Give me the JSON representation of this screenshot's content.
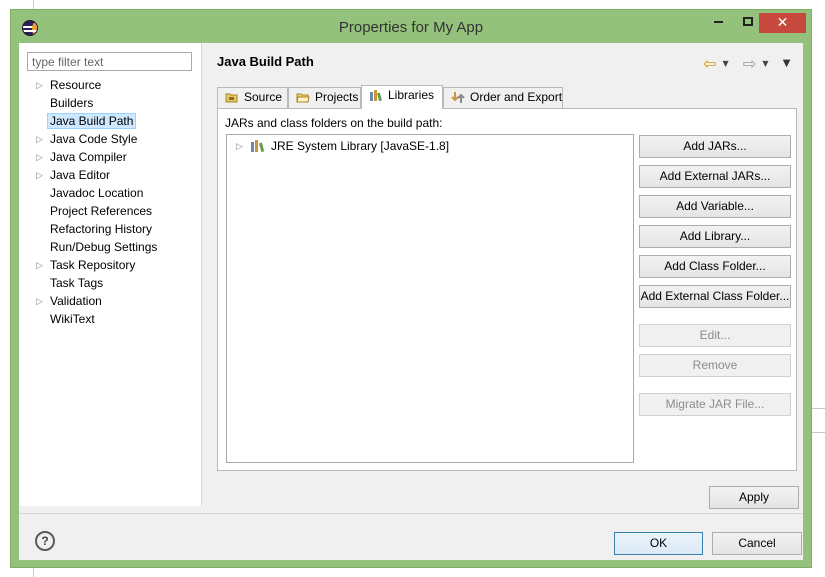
{
  "window": {
    "title": "Properties for My App",
    "accent_color": "#94c17c",
    "close_color": "#c7493d"
  },
  "sidebar": {
    "filter_placeholder": "type filter text",
    "items": [
      {
        "label": "Resource",
        "expandable": true
      },
      {
        "label": "Builders",
        "expandable": false
      },
      {
        "label": "Java Build Path",
        "expandable": false,
        "selected": true
      },
      {
        "label": "Java Code Style",
        "expandable": true
      },
      {
        "label": "Java Compiler",
        "expandable": true
      },
      {
        "label": "Java Editor",
        "expandable": true
      },
      {
        "label": "Javadoc Location",
        "expandable": false
      },
      {
        "label": "Project References",
        "expandable": false
      },
      {
        "label": "Refactoring History",
        "expandable": false
      },
      {
        "label": "Run/Debug Settings",
        "expandable": false
      },
      {
        "label": "Task Repository",
        "expandable": true
      },
      {
        "label": "Task Tags",
        "expandable": false
      },
      {
        "label": "Validation",
        "expandable": true
      },
      {
        "label": "WikiText",
        "expandable": false
      }
    ]
  },
  "main": {
    "title": "Java Build Path",
    "tabs": [
      {
        "label": "Source",
        "icon": "source-folder-icon"
      },
      {
        "label": "Projects",
        "icon": "projects-folder-icon"
      },
      {
        "label": "Libraries",
        "icon": "libraries-icon",
        "active": true
      },
      {
        "label": "Order and Export",
        "icon": "order-export-icon"
      }
    ],
    "panel_label": "JARs and class folders on the build path:",
    "libraries": [
      {
        "label": "JRE System Library [JavaSE-1.8]",
        "icon": "library-icon"
      }
    ],
    "buttons": [
      {
        "label": "Add JARs...",
        "enabled": true
      },
      {
        "label": "Add External JARs...",
        "enabled": true
      },
      {
        "label": "Add Variable...",
        "enabled": true
      },
      {
        "label": "Add Library...",
        "enabled": true
      },
      {
        "label": "Add Class Folder...",
        "enabled": true
      },
      {
        "label": "Add External Class Folder...",
        "enabled": true
      },
      {
        "label": "Edit...",
        "enabled": false
      },
      {
        "label": "Remove",
        "enabled": false
      },
      {
        "label": "Migrate JAR File...",
        "enabled": false
      }
    ],
    "apply_label": "Apply"
  },
  "footer": {
    "help_symbol": "?",
    "ok_label": "OK",
    "cancel_label": "Cancel"
  }
}
